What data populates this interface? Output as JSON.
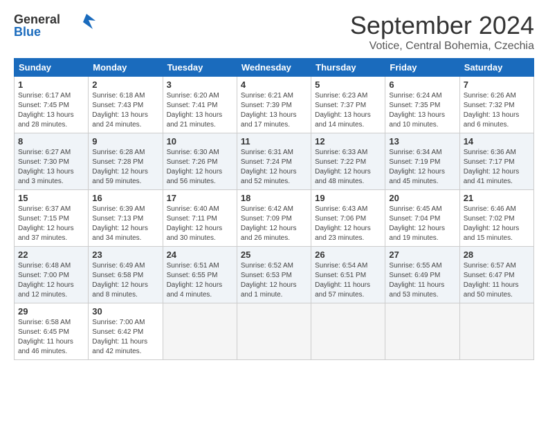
{
  "logo": {
    "brand": "General",
    "brand2": "Blue"
  },
  "title": "September 2024",
  "subtitle": "Votice, Central Bohemia, Czechia",
  "days_header": [
    "Sunday",
    "Monday",
    "Tuesday",
    "Wednesday",
    "Thursday",
    "Friday",
    "Saturday"
  ],
  "weeks": [
    [
      {
        "day": "1",
        "text": "Sunrise: 6:17 AM\nSunset: 7:45 PM\nDaylight: 13 hours\nand 28 minutes."
      },
      {
        "day": "2",
        "text": "Sunrise: 6:18 AM\nSunset: 7:43 PM\nDaylight: 13 hours\nand 24 minutes."
      },
      {
        "day": "3",
        "text": "Sunrise: 6:20 AM\nSunset: 7:41 PM\nDaylight: 13 hours\nand 21 minutes."
      },
      {
        "day": "4",
        "text": "Sunrise: 6:21 AM\nSunset: 7:39 PM\nDaylight: 13 hours\nand 17 minutes."
      },
      {
        "day": "5",
        "text": "Sunrise: 6:23 AM\nSunset: 7:37 PM\nDaylight: 13 hours\nand 14 minutes."
      },
      {
        "day": "6",
        "text": "Sunrise: 6:24 AM\nSunset: 7:35 PM\nDaylight: 13 hours\nand 10 minutes."
      },
      {
        "day": "7",
        "text": "Sunrise: 6:26 AM\nSunset: 7:32 PM\nDaylight: 13 hours\nand 6 minutes."
      }
    ],
    [
      {
        "day": "8",
        "text": "Sunrise: 6:27 AM\nSunset: 7:30 PM\nDaylight: 13 hours\nand 3 minutes."
      },
      {
        "day": "9",
        "text": "Sunrise: 6:28 AM\nSunset: 7:28 PM\nDaylight: 12 hours\nand 59 minutes."
      },
      {
        "day": "10",
        "text": "Sunrise: 6:30 AM\nSunset: 7:26 PM\nDaylight: 12 hours\nand 56 minutes."
      },
      {
        "day": "11",
        "text": "Sunrise: 6:31 AM\nSunset: 7:24 PM\nDaylight: 12 hours\nand 52 minutes."
      },
      {
        "day": "12",
        "text": "Sunrise: 6:33 AM\nSunset: 7:22 PM\nDaylight: 12 hours\nand 48 minutes."
      },
      {
        "day": "13",
        "text": "Sunrise: 6:34 AM\nSunset: 7:19 PM\nDaylight: 12 hours\nand 45 minutes."
      },
      {
        "day": "14",
        "text": "Sunrise: 6:36 AM\nSunset: 7:17 PM\nDaylight: 12 hours\nand 41 minutes."
      }
    ],
    [
      {
        "day": "15",
        "text": "Sunrise: 6:37 AM\nSunset: 7:15 PM\nDaylight: 12 hours\nand 37 minutes."
      },
      {
        "day": "16",
        "text": "Sunrise: 6:39 AM\nSunset: 7:13 PM\nDaylight: 12 hours\nand 34 minutes."
      },
      {
        "day": "17",
        "text": "Sunrise: 6:40 AM\nSunset: 7:11 PM\nDaylight: 12 hours\nand 30 minutes."
      },
      {
        "day": "18",
        "text": "Sunrise: 6:42 AM\nSunset: 7:09 PM\nDaylight: 12 hours\nand 26 minutes."
      },
      {
        "day": "19",
        "text": "Sunrise: 6:43 AM\nSunset: 7:06 PM\nDaylight: 12 hours\nand 23 minutes."
      },
      {
        "day": "20",
        "text": "Sunrise: 6:45 AM\nSunset: 7:04 PM\nDaylight: 12 hours\nand 19 minutes."
      },
      {
        "day": "21",
        "text": "Sunrise: 6:46 AM\nSunset: 7:02 PM\nDaylight: 12 hours\nand 15 minutes."
      }
    ],
    [
      {
        "day": "22",
        "text": "Sunrise: 6:48 AM\nSunset: 7:00 PM\nDaylight: 12 hours\nand 12 minutes."
      },
      {
        "day": "23",
        "text": "Sunrise: 6:49 AM\nSunset: 6:58 PM\nDaylight: 12 hours\nand 8 minutes."
      },
      {
        "day": "24",
        "text": "Sunrise: 6:51 AM\nSunset: 6:55 PM\nDaylight: 12 hours\nand 4 minutes."
      },
      {
        "day": "25",
        "text": "Sunrise: 6:52 AM\nSunset: 6:53 PM\nDaylight: 12 hours\nand 1 minute."
      },
      {
        "day": "26",
        "text": "Sunrise: 6:54 AM\nSunset: 6:51 PM\nDaylight: 11 hours\nand 57 minutes."
      },
      {
        "day": "27",
        "text": "Sunrise: 6:55 AM\nSunset: 6:49 PM\nDaylight: 11 hours\nand 53 minutes."
      },
      {
        "day": "28",
        "text": "Sunrise: 6:57 AM\nSunset: 6:47 PM\nDaylight: 11 hours\nand 50 minutes."
      }
    ],
    [
      {
        "day": "29",
        "text": "Sunrise: 6:58 AM\nSunset: 6:45 PM\nDaylight: 11 hours\nand 46 minutes."
      },
      {
        "day": "30",
        "text": "Sunrise: 7:00 AM\nSunset: 6:42 PM\nDaylight: 11 hours\nand 42 minutes."
      },
      {
        "day": "",
        "text": ""
      },
      {
        "day": "",
        "text": ""
      },
      {
        "day": "",
        "text": ""
      },
      {
        "day": "",
        "text": ""
      },
      {
        "day": "",
        "text": ""
      }
    ]
  ]
}
